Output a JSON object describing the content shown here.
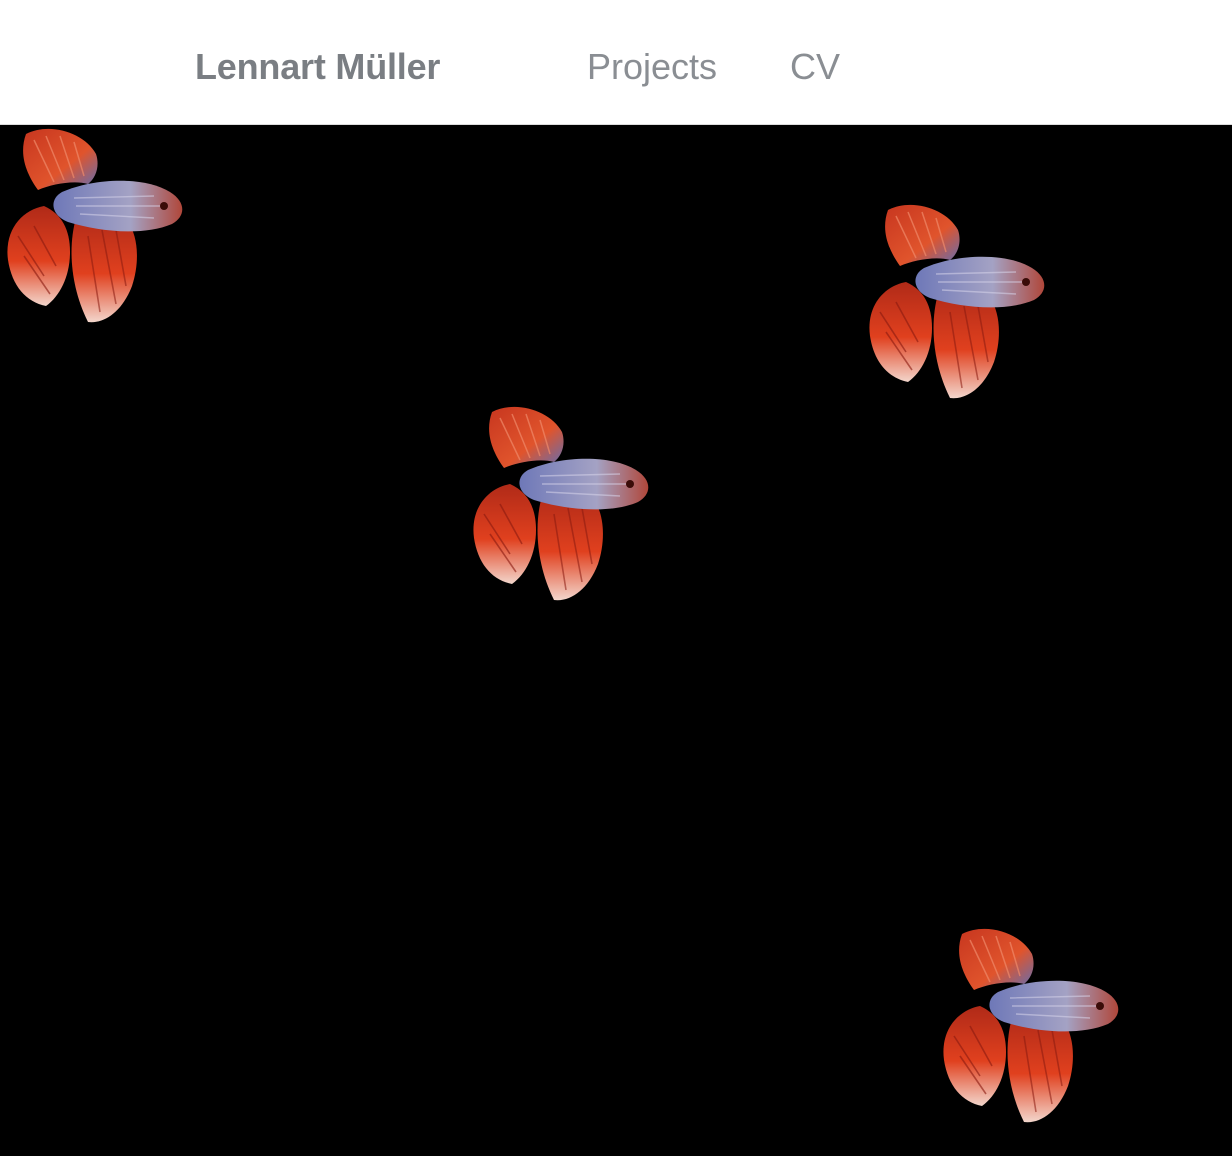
{
  "header": {
    "brand": "Lennart Müller",
    "nav": [
      {
        "label": "Projects"
      },
      {
        "label": "CV"
      }
    ]
  },
  "colors": {
    "header_bg": "#ffffff",
    "brand_text": "#7a7e83",
    "nav_text": "#8a8e93",
    "stage_bg": "#000000",
    "fish_fin": "#d8371f",
    "fish_body": "#8c8fb8"
  },
  "stage": {
    "sprite": "betta-fish-icon",
    "fish_count": 4
  }
}
